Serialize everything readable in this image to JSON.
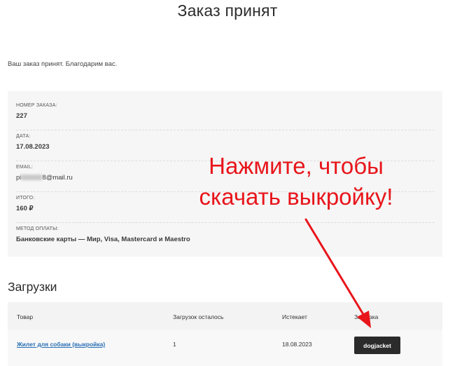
{
  "page": {
    "title": "Заказ принят"
  },
  "thanks_text": "Ваш заказ принят. Благодарим вас.",
  "order_overview": {
    "order_number": {
      "label": "НОМЕР ЗАКАЗА:",
      "value": "227"
    },
    "date": {
      "label": "ДАТА:",
      "value": "17.08.2023"
    },
    "email": {
      "label": "EMAIL:",
      "value_prefix": "pi",
      "value_suffix": "8@mail.ru"
    },
    "total": {
      "label": "ИТОГО:",
      "value": "160 ₽"
    },
    "payment_method": {
      "label": "МЕТОД ОПЛАТЫ:",
      "value": "Банковские карты — Мир, Visa, Mastercard и Maestro"
    }
  },
  "downloads": {
    "heading": "Загрузки",
    "columns": [
      "Товар",
      "Загрузок осталось",
      "Истекает",
      "Загрузка"
    ],
    "rows": [
      {
        "product": "Жилет для собаки (выкройка)",
        "remaining": "1",
        "expires": "18.08.2023",
        "download_label": "dogjacket"
      }
    ]
  },
  "annotation": {
    "line1": "Нажмите, чтобы",
    "line2": "скачать выкройку!",
    "color": "#e8151b"
  }
}
